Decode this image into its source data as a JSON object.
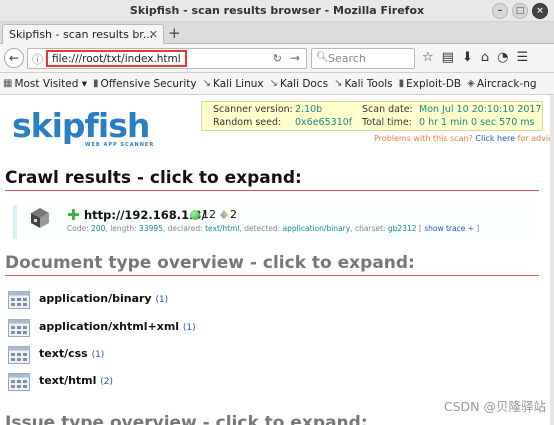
{
  "window": {
    "title": "Skipfish - scan results browser - Mozilla Firefox"
  },
  "tab": {
    "label": "Skipfish - scan results br..."
  },
  "navbar": {
    "url": "file:///root/txt/index.html",
    "search_placeholder": "Search"
  },
  "bookmarks": [
    {
      "label": "Most Visited ▾"
    },
    {
      "label": "Offensive Security"
    },
    {
      "label": "Kali Linux"
    },
    {
      "label": "Kali Docs"
    },
    {
      "label": "Kali Tools"
    },
    {
      "label": "Exploit-DB"
    },
    {
      "label": "Aircrack-ng"
    }
  ],
  "header": {
    "logo": "skipfish",
    "logo_sub": "WEB APP SCANNER",
    "scanner_version_label": "Scanner version:",
    "scanner_version": "2.10b",
    "scan_date_label": "Scan date:",
    "scan_date": "Mon Jul 10 20:10:10 2017",
    "random_seed_label": "Random seed:",
    "random_seed": "0x6e65310f",
    "total_time_label": "Total time:",
    "total_time": "0 hr 1 min 0 sec 570 ms",
    "problems_text": "Problems with this scan?",
    "problems_link": "Click here",
    "problems_suffix": "for advice."
  },
  "crawl": {
    "title": "Crawl results - click to expand:",
    "url": "http://192.168.1.3/",
    "count_a": "12",
    "count_b": "2",
    "meta": {
      "code_label": "Code:",
      "code": "200",
      "length_label": ", length:",
      "length": "33995",
      "declared_label": ", declared:",
      "declared": "text/html",
      "detected_label": ", detected:",
      "detected": "application/binary",
      "charset_label": ", charset:",
      "charset": "gb2312",
      "trace_pre": "[",
      "trace_link": "show trace +",
      "trace_post": "]"
    }
  },
  "doc_types": {
    "title": "Document type overview - click to expand:",
    "items": [
      {
        "label": "application/binary",
        "count": "(1)"
      },
      {
        "label": "application/xhtml+xml",
        "count": "(1)"
      },
      {
        "label": "text/css",
        "count": "(1)"
      },
      {
        "label": "text/html",
        "count": "(2)"
      }
    ]
  },
  "issues": {
    "title": "Issue type overview - click to expand:"
  },
  "watermark": "CSDN @贝隆驿站"
}
